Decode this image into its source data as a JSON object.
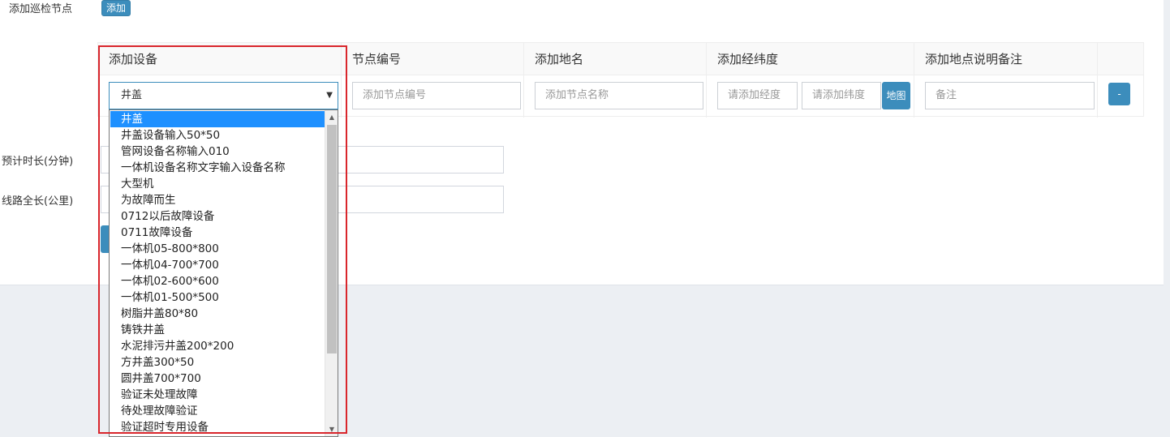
{
  "form": {
    "add_node_label": "添加巡检节点",
    "add_button": "添加",
    "duration_label": "预计时长(分钟)",
    "length_label": "线路全长(公里)"
  },
  "table": {
    "headers": [
      "添加设备",
      "节点编号",
      "添加地名",
      "添加经纬度",
      "添加地点说明备注"
    ],
    "device_selected": "井盖",
    "node_number_placeholder": "添加节点编号",
    "place_name_placeholder": "添加节点名称",
    "longitude_placeholder": "请添加经度",
    "latitude_placeholder": "请添加纬度",
    "map_button": "地图",
    "remark_placeholder": "备注",
    "remove_button": "-"
  },
  "dropdown": {
    "selected_index": 0,
    "options": [
      "井盖",
      "井盖设备输入50*50",
      "管网设备名称输入010",
      "一体机设备名称文字输入设备名称",
      "大型机",
      "为故障而生",
      "0712以后故障设备",
      "0711故障设备",
      "一体机05-800*800",
      "一体机04-700*700",
      "一体机02-600*600",
      "一体机01-500*500",
      "树脂井盖80*80",
      "铸铁井盖",
      "水泥排污井盖200*200",
      "方井盖300*50",
      "圆井盖700*700",
      "验证未处理故障",
      "待处理故障验证",
      "验证超时专用设备"
    ]
  },
  "icons": {
    "select_arrow": "caret-down-icon",
    "scroll_up": "scroll-up-arrow-icon",
    "scroll_down": "scroll-down-arrow-icon"
  },
  "colors": {
    "primary": "#3c8dbc",
    "selected_option": "#1e90ff",
    "highlight_frame": "#d9262c",
    "page_background": "#eceff3"
  }
}
